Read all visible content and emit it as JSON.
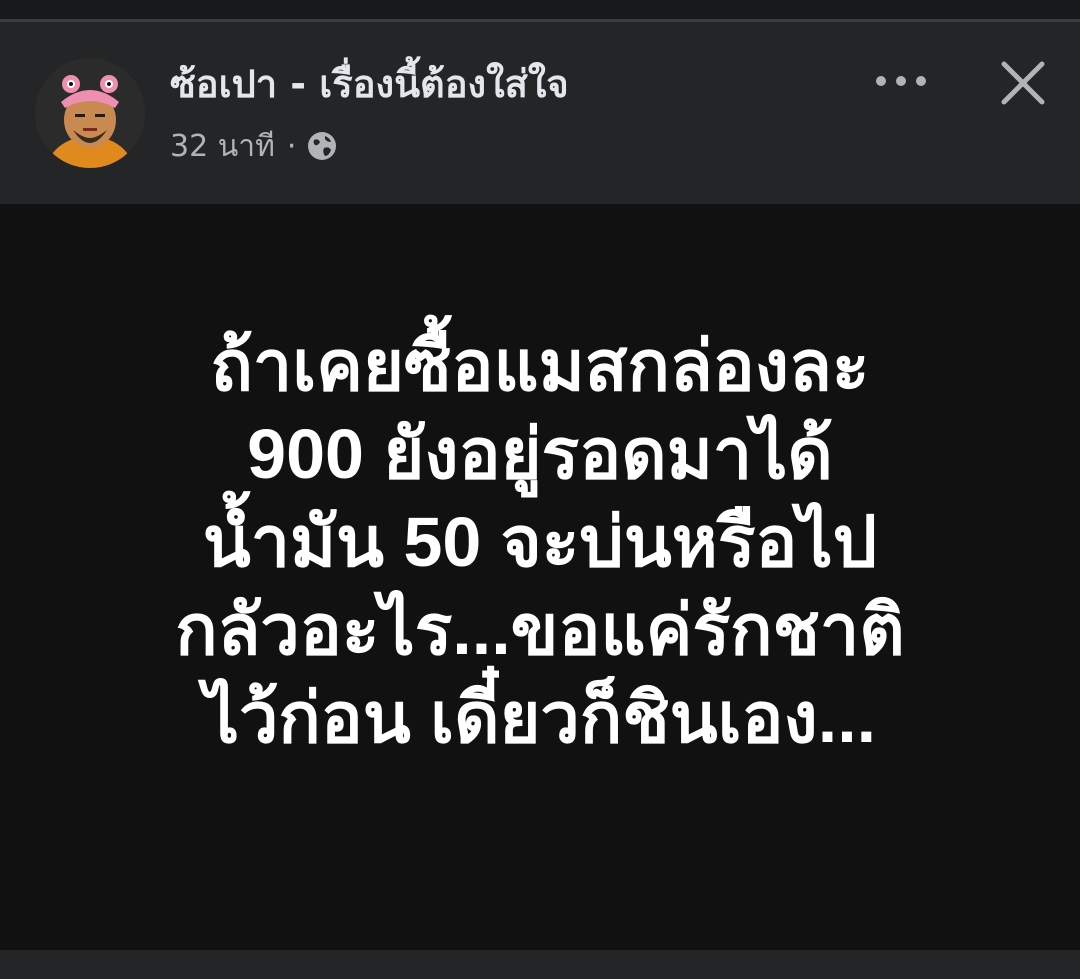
{
  "header": {
    "page_name": "ซ้อเปา - เรื่องนี้ต้องใส่ใจ",
    "timestamp": "32 นาที",
    "separator": "·",
    "privacy_icon": "globe-icon",
    "more_icon": "more-options-icon",
    "close_icon": "close-icon"
  },
  "post": {
    "lines": [
      "ถ้าเคยซื้อแมสกล่องละ",
      "900 ยังอยู่รอดมาได้",
      "น้ำมัน 50 จะบ่นหรือไป",
      "กลัวอะไร...ขอแค่รักชาติ",
      "ไว้ก่อน เดี๋ยวก็ชินเอง..."
    ]
  },
  "colors": {
    "header_bg": "#242526",
    "post_bg": "#111111",
    "name_text": "#e4e6eb",
    "meta_text": "#b0b3b8",
    "post_text": "#ffffff"
  }
}
